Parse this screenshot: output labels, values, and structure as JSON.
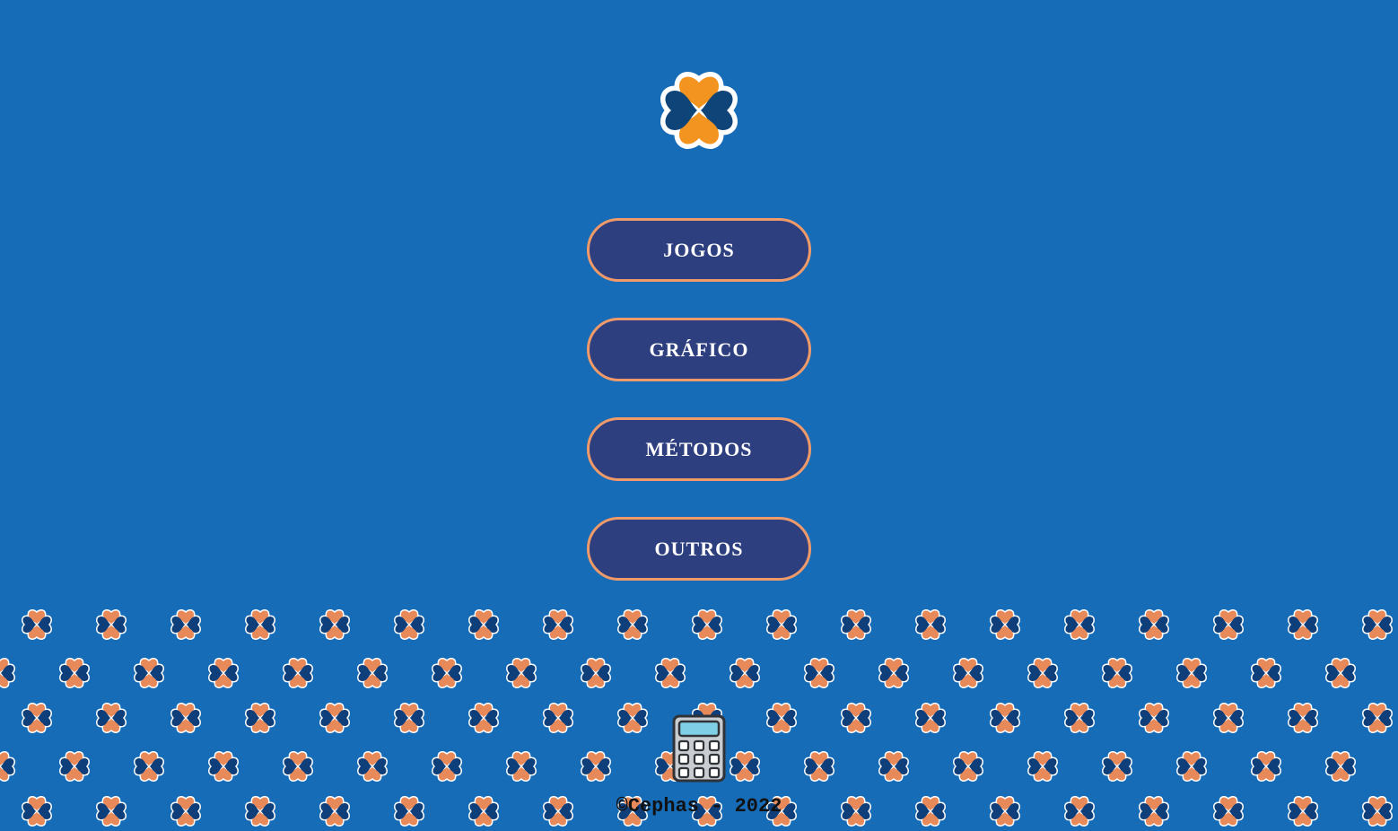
{
  "logo": {
    "icon": "clover-logo-icon"
  },
  "menu": {
    "items": [
      {
        "label": "JOGOS"
      },
      {
        "label": "GRÁFICO"
      },
      {
        "label": "MÉTODOS"
      },
      {
        "label": "OUTROS"
      }
    ]
  },
  "calculator": {
    "icon": "calculator-icon"
  },
  "footer": {
    "text": "©Cephas - 2022"
  },
  "colors": {
    "background": "#176cb8",
    "button_fill": "#2e3f80",
    "button_border": "#f09a6a",
    "clover_orange": "#f49420",
    "clover_navy": "#0e4478"
  }
}
